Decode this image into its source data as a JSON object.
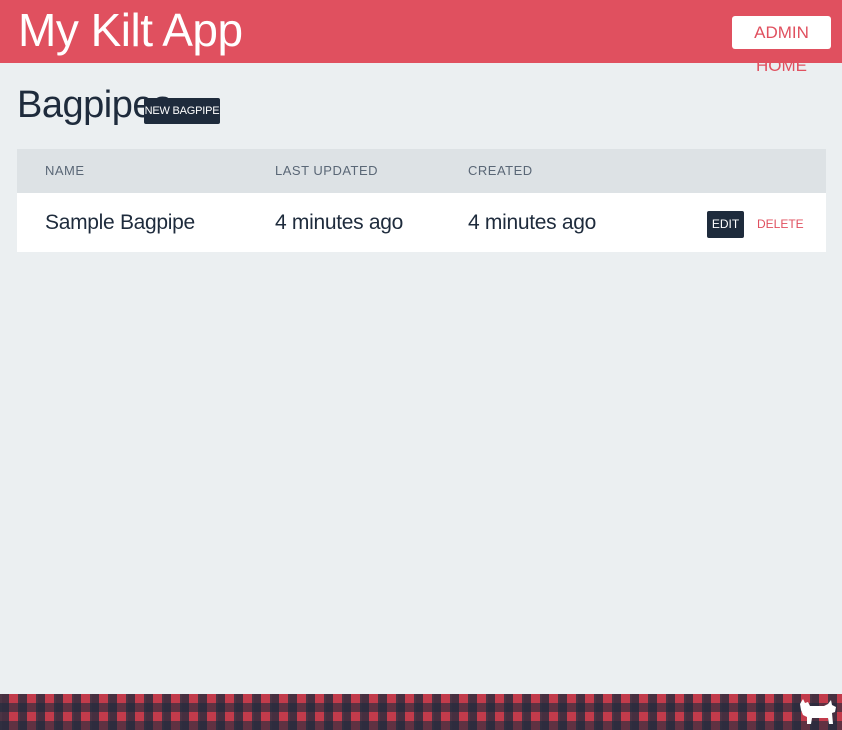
{
  "header": {
    "app_title": "My Kilt App",
    "admin_home_label": "ADMIN HOME"
  },
  "page": {
    "title": "Bagpipes",
    "new_button_label": "NEW BAGPIPE"
  },
  "table": {
    "columns": [
      "NAME",
      "LAST UPDATED",
      "CREATED"
    ],
    "rows": [
      {
        "name": "Sample Bagpipe",
        "last_updated": "4 minutes ago",
        "created": "4 minutes ago",
        "edit_label": "EDIT",
        "delete_label": "DELETE"
      }
    ]
  },
  "colors": {
    "header_bg": "#e0505f",
    "accent_dark": "#1e2b3c",
    "page_bg": "#ebeff1",
    "delete_text": "#e0505f"
  },
  "icons": {
    "footer_mascot": "scottie-dog-icon"
  }
}
